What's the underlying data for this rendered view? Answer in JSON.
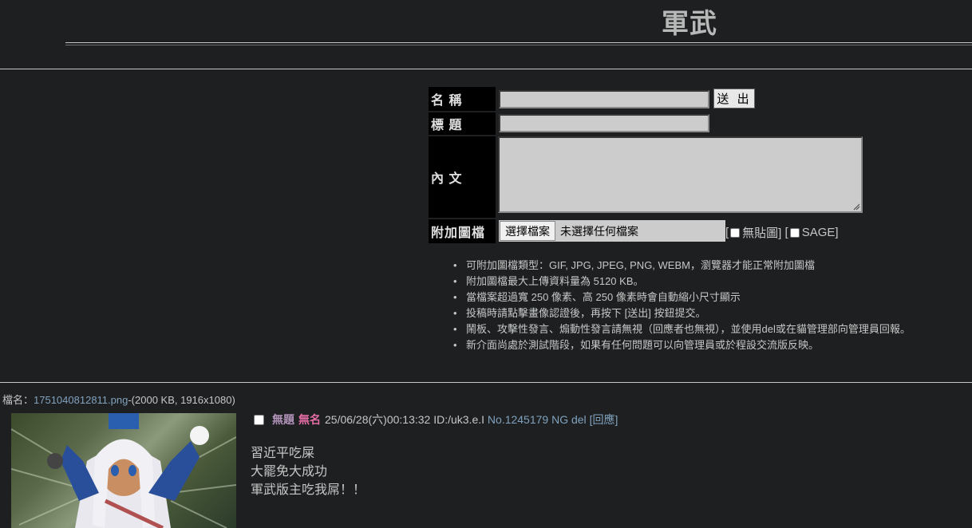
{
  "board": {
    "title": "軍武"
  },
  "form": {
    "name_label": "名 稱",
    "subject_label": "標 題",
    "content_label": "內 文",
    "attach_label": "附加圖檔",
    "submit_label": "送 出",
    "file_button": "選擇檔案",
    "file_none": "未選擇任何檔案",
    "noimg_label": "無貼圖]",
    "sage_label": "SAGE]"
  },
  "rules": [
    "可附加圖檔類型：GIF, JPG, JPEG, PNG, WEBM，瀏覽器才能正常附加圖檔",
    "附加圖檔最大上傳資料量為 5120 KB。",
    "當檔案超過寬 250 像素、高 250 像素時會自動縮小尺寸顯示",
    "投稿時請點擊畫像認證後，再按下 [送出] 按鈕提交。",
    "鬧板、攻擊性發言、煽動性發言請無視（回應者也無視），並使用del或在貓管理部向管理員回報。",
    "新介面尚處於測試階段，如果有任何問題可以向管理員或於程設交流版反映。"
  ],
  "post": {
    "file_prefix": "檔名：",
    "file_name": "1751040812811.png",
    "file_info": "-(2000 KB, 1916x1080)",
    "subject": "無題",
    "name": "無名",
    "datetime": "25/06/28(六)00:13:32 ID:/uk3.e.I",
    "number": "No.1245179",
    "ng": "NG",
    "del": "del",
    "reply": "[回應]",
    "body": [
      "習近平吃屎",
      "大罷免大成功",
      "軍武版主吃我屌！！"
    ]
  }
}
